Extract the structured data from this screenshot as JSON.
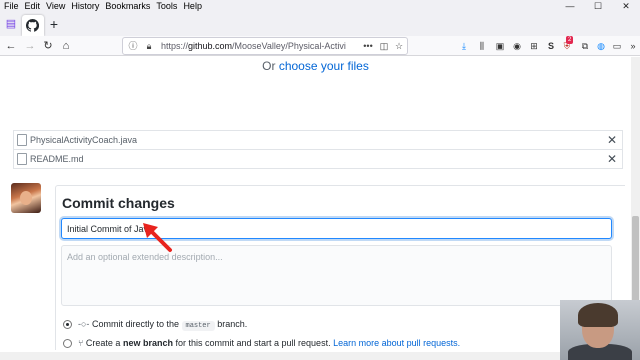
{
  "browser": {
    "menu": [
      "File",
      "Edit",
      "View",
      "History",
      "Bookmarks",
      "Tools",
      "Help"
    ],
    "new_tab_symbol": "+",
    "url_prefix": "https://",
    "url_host": "github.com",
    "url_path": "/MooseValley/Physical-Activi",
    "badge_count": "2",
    "accent": "#0366d6"
  },
  "upload": {
    "or_text": "Or",
    "choose_link": "choose your files",
    "files": [
      "PhysicalActivityCoach.java",
      "README.md"
    ]
  },
  "commit": {
    "title": "Commit changes",
    "summary_value": "Initial Commit of Java",
    "description_placeholder": "Add an optional extended description...",
    "option_direct_before": "Commit directly to the",
    "branch_name": "master",
    "option_direct_after": "branch.",
    "option_new_before": "Create a",
    "option_new_bold": "new branch",
    "option_new_after": "for this commit and start a pull request.",
    "learn_more": "Learn more about pull requests."
  }
}
